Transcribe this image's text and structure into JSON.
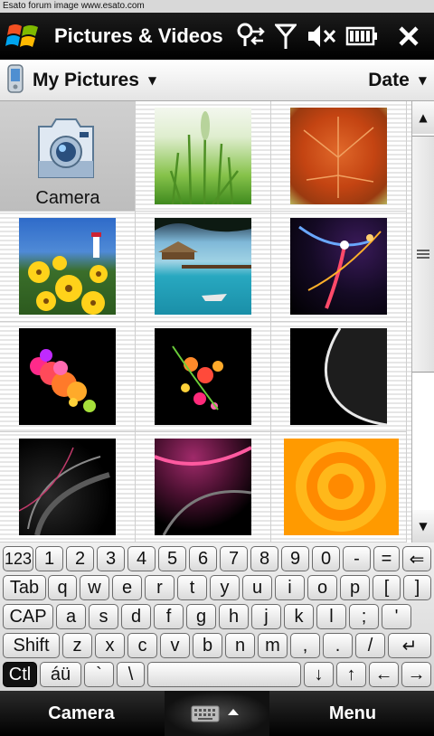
{
  "watermark": "Esato forum image www.esato.com",
  "titlebar": {
    "title": "Pictures & Videos",
    "icons": [
      "windows-start-icon",
      "connectivity-icon",
      "signal-icon",
      "volume-muted-icon",
      "battery-icon",
      "close-icon"
    ]
  },
  "filterbar": {
    "folder": "My Pictures",
    "sort": "Date"
  },
  "grid": {
    "camera_label": "Camera",
    "thumbnails": [
      "grass",
      "autumn-leaf",
      "yellow-flowers",
      "beach-pier",
      "light-streaks",
      "color-bubbles",
      "abstract-splash",
      "dark-curve",
      "dark-swirl",
      "pink-wave",
      "orange-rings"
    ]
  },
  "keyboard": {
    "rows": [
      [
        "123",
        "1",
        "2",
        "3",
        "4",
        "5",
        "6",
        "7",
        "8",
        "9",
        "0",
        "-",
        "=",
        "⇐"
      ],
      [
        "Tab",
        "q",
        "w",
        "e",
        "r",
        "t",
        "y",
        "u",
        "i",
        "o",
        "p",
        "[",
        "]"
      ],
      [
        "CAP",
        "a",
        "s",
        "d",
        "f",
        "g",
        "h",
        "j",
        "k",
        "l",
        ";",
        "'"
      ],
      [
        "Shift",
        "z",
        "x",
        "c",
        "v",
        "b",
        "n",
        "m",
        ",",
        ".",
        "/",
        "↵"
      ],
      [
        "Ctl",
        "áü",
        "`",
        "\\",
        "",
        "↓",
        "↑",
        "←",
        "→"
      ]
    ]
  },
  "softkeys": {
    "left": "Camera",
    "right": "Menu"
  }
}
